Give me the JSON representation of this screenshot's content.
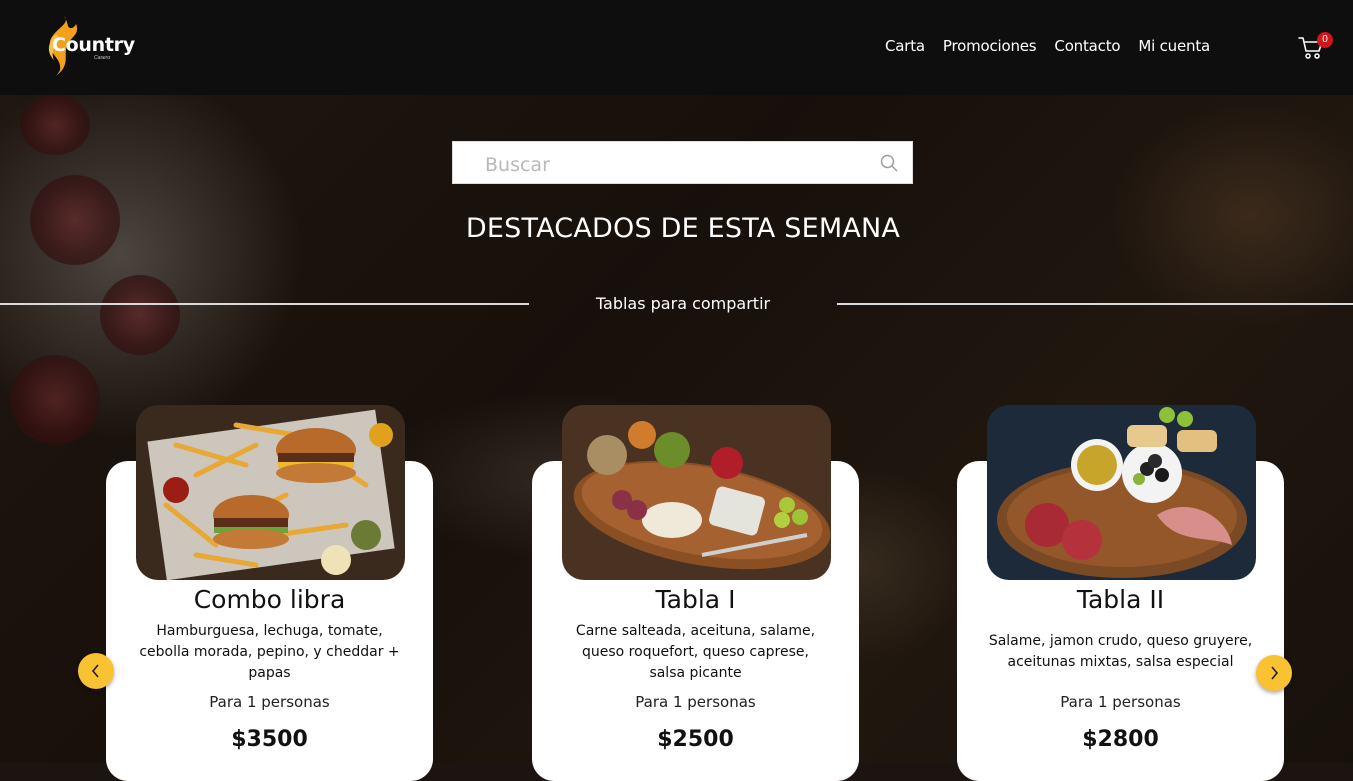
{
  "brand": {
    "name": "Country",
    "tagline": "Casero"
  },
  "nav": {
    "items": [
      {
        "label": "Carta"
      },
      {
        "label": "Promociones"
      },
      {
        "label": "Contacto"
      },
      {
        "label": "Mi cuenta"
      }
    ]
  },
  "cart": {
    "count": "0"
  },
  "search": {
    "placeholder": "Buscar"
  },
  "section": {
    "title": "DESTACADOS DE ESTA SEMANA",
    "category": "Tablas para compartir"
  },
  "products": [
    {
      "name": "Combo libra",
      "description": "Hamburguesa, lechuga, tomate, cebolla morada, pepino, y cheddar + papas",
      "people": "Para 1 personas",
      "price": "$3500"
    },
    {
      "name": "Tabla I",
      "description": "Carne salteada, aceituna, salame, queso roquefort, queso caprese, salsa picante",
      "people": "Para 1 personas",
      "price": "$2500"
    },
    {
      "name": "Tabla II",
      "description": "Salame, jamon crudo, queso gruyere, aceitunas mixtas, salsa especial",
      "people": "Para 1 personas",
      "price": "$2800"
    }
  ],
  "colors": {
    "accent": "#f8c232",
    "topbar": "#0e0e0e",
    "badge": "#d0151b"
  },
  "icons": {
    "search": "search-icon",
    "cart": "cart-icon",
    "prev": "chevron-left-icon",
    "next": "chevron-right-icon"
  }
}
